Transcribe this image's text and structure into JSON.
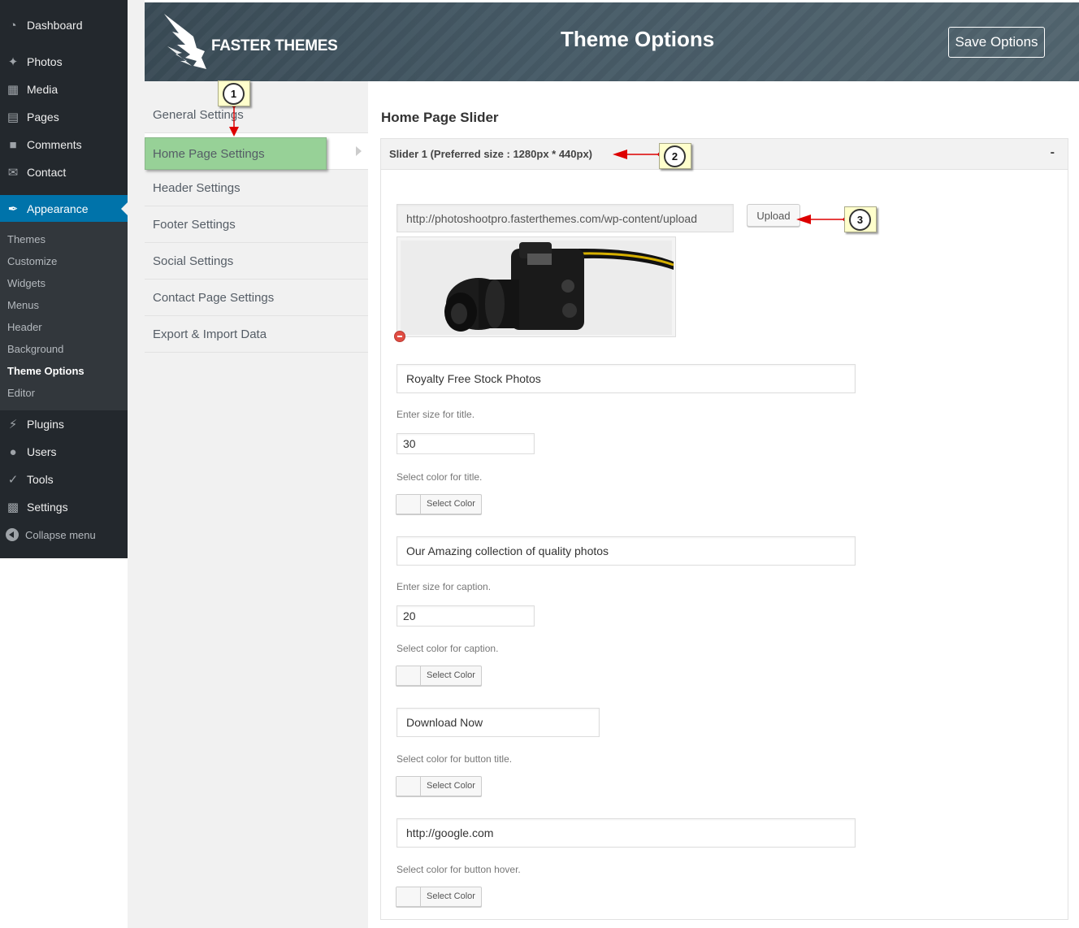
{
  "wp_menu": {
    "items": [
      {
        "label": "Dashboard",
        "icon": "dashboard-icon"
      },
      {
        "label": "Photos",
        "icon": "pin-icon"
      },
      {
        "label": "Media",
        "icon": "media-icon"
      },
      {
        "label": "Pages",
        "icon": "pages-icon"
      },
      {
        "label": "Comments",
        "icon": "comment-icon"
      },
      {
        "label": "Contact",
        "icon": "mail-icon"
      },
      {
        "label": "Appearance",
        "icon": "brush-icon"
      },
      {
        "label": "Plugins",
        "icon": "plugin-icon"
      },
      {
        "label": "Users",
        "icon": "user-icon"
      },
      {
        "label": "Tools",
        "icon": "wrench-icon"
      },
      {
        "label": "Settings",
        "icon": "settings-icon"
      }
    ],
    "submenu": [
      "Themes",
      "Customize",
      "Widgets",
      "Menus",
      "Header",
      "Background",
      "Theme Options",
      "Editor"
    ],
    "collapse_label": "Collapse menu"
  },
  "header": {
    "logo_text": "FASTER THEMES",
    "title": "Theme Options",
    "save_label": "Save Options"
  },
  "settings_nav": {
    "tabs": [
      "General Settings",
      "Home Page Settings",
      "Header Settings",
      "Footer Settings",
      "Social Settings",
      "Contact Page Settings",
      "Export & Import Data"
    ]
  },
  "main": {
    "section_title": "Home Page Slider",
    "slider_label": "Slider 1 (Preferred size : 1280px * 440px)",
    "slider_toggle": "-",
    "image_url": "http://photoshootpro.fasterthemes.com/wp-content/upload",
    "upload_label": "Upload",
    "title_value": "Royalty Free Stock Photos",
    "title_size_hint": "Enter size for title.",
    "title_size": "30",
    "title_color_hint": "Select color for title.",
    "caption_value": "Our Amazing collection of quality photos",
    "caption_size_hint": "Enter size for caption.",
    "caption_size": "20",
    "caption_color_hint": "Select color for caption.",
    "button_title_value": "Download Now",
    "button_title_color_hint": "Select color for button title.",
    "button_link_value": "http://google.com",
    "button_hover_color_hint": "Select color for button hover.",
    "select_color_label": "Select Color"
  },
  "annotations": [
    "1",
    "2",
    "3"
  ],
  "colors": {
    "sidebar": "#23282d",
    "active_menu": "#0073aa",
    "tab_highlight": "#97d197",
    "callout": "#ffffcc",
    "arrow": "#dd0000"
  }
}
